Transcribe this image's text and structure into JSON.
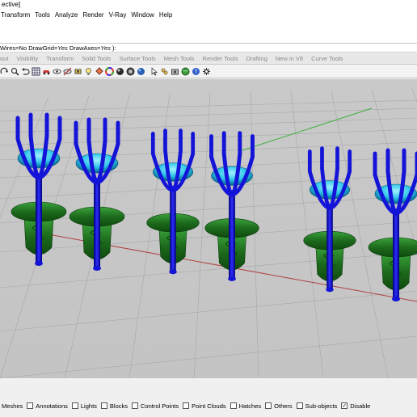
{
  "window": {
    "title_fragment": "ective]"
  },
  "menu": [
    "Transform",
    "Tools",
    "Analyze",
    "Render",
    "V-Ray",
    "Window",
    "Help"
  ],
  "command_line": {
    "prefix": "Wires=No  DrawGrid=",
    "drawgrid_value": "Yes",
    "middle": "  DrawAxes=",
    "drawaxes_value": "Yes",
    "suffix": " ):"
  },
  "tabs": [
    "out",
    "Visibility",
    "Transform",
    "Solid Tools",
    "Surface Tools",
    "Mesh Tools",
    "Render Tools",
    "Drafting",
    "New in V8",
    "Curve Tools"
  ],
  "toolbar_icons": [
    "rotate-view-icon",
    "zoom-window-icon",
    "undo-view-icon",
    "grid-icon",
    "car-icon",
    "eye-icon",
    "hide-icon",
    "rotate-camera-icon",
    "light-icon",
    "paint-bucket-icon",
    "color-wheel-icon",
    "shaded-sphere-icon",
    "render-icon",
    "sphere-icon",
    "pointer-icon",
    "named-views-icon",
    "snapshot-icon",
    "globe-icon",
    "help-icon",
    "settings-icon"
  ],
  "osnaps": [
    {
      "label": "Meshes",
      "checked": false,
      "show_box": false
    },
    {
      "label": "Annotations",
      "checked": false,
      "show_box": true
    },
    {
      "label": "Lights",
      "checked": false,
      "show_box": true
    },
    {
      "label": "Blocks",
      "checked": false,
      "show_box": true
    },
    {
      "label": "Control Points",
      "checked": false,
      "show_box": true
    },
    {
      "label": "Point Clouds",
      "checked": false,
      "show_box": true
    },
    {
      "label": "Hatches",
      "checked": false,
      "show_box": true
    },
    {
      "label": "Others",
      "checked": false,
      "show_box": true
    },
    {
      "label": "Sub-objects",
      "checked": false,
      "show_box": true
    },
    {
      "label": "Disable",
      "checked": true,
      "show_box": true
    }
  ],
  "colors": {
    "prong_blue": "#1414d8",
    "gem_cyan": "#2ec4e8",
    "back_green": "#1d6b1d",
    "grid_line": "#a8a8a8",
    "axis_red": "#b04040",
    "axis_green": "#3fae3f"
  }
}
